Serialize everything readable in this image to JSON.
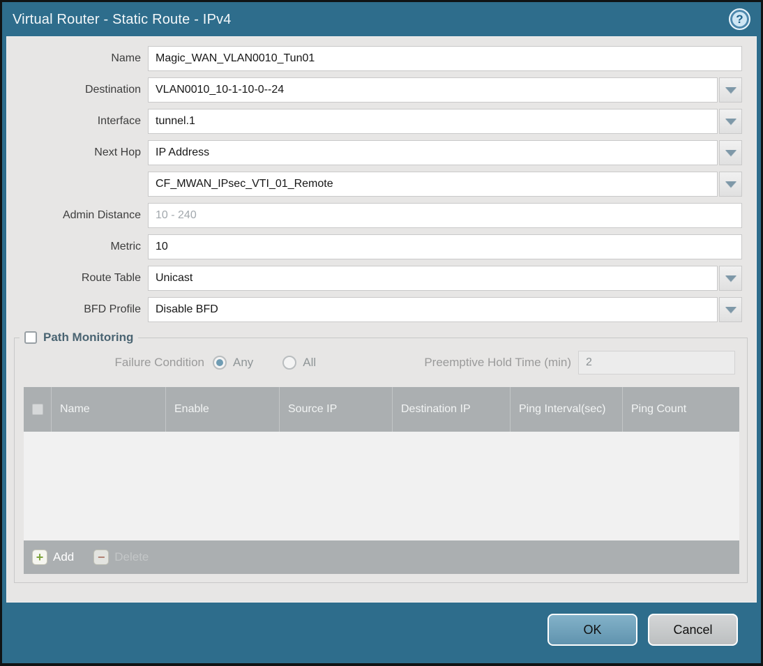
{
  "dialog": {
    "title": "Virtual Router - Static Route - IPv4",
    "help_icon": "?",
    "fields": {
      "name": {
        "label": "Name",
        "value": "Magic_WAN_VLAN0010_Tun01"
      },
      "destination": {
        "label": "Destination",
        "value": "VLAN0010_10-1-10-0--24"
      },
      "interface": {
        "label": "Interface",
        "value": "tunnel.1"
      },
      "next_hop": {
        "label": "Next Hop",
        "value": "IP Address"
      },
      "next_hop_addr": {
        "label": "",
        "value": "CF_MWAN_IPsec_VTI_01_Remote"
      },
      "admin_distance": {
        "label": "Admin Distance",
        "value": "",
        "placeholder": "10 - 240"
      },
      "metric": {
        "label": "Metric",
        "value": "10"
      },
      "route_table": {
        "label": "Route Table",
        "value": "Unicast"
      },
      "bfd_profile": {
        "label": "BFD Profile",
        "value": "Disable BFD"
      }
    },
    "path_monitoring": {
      "label": "Path Monitoring",
      "checked": false,
      "failure_condition": {
        "label": "Failure Condition",
        "option_any": "Any",
        "option_all": "All",
        "selected": "Any"
      },
      "preemptive_hold_time": {
        "label": "Preemptive Hold Time (min)",
        "value": "2",
        "disabled": true
      },
      "table": {
        "columns": [
          "Name",
          "Enable",
          "Source IP",
          "Destination IP",
          "Ping Interval(sec)",
          "Ping Count"
        ],
        "rows": []
      },
      "add_label": "Add",
      "delete_label": "Delete",
      "delete_disabled": true
    },
    "buttons": {
      "ok": "OK",
      "cancel": "Cancel"
    },
    "colors": {
      "titlebar_teal": "#2e6d8c",
      "panel_bg": "#e7e6e5",
      "table_header_gray": "#abafb1",
      "ok_button_blue": "#6fa3bd",
      "cancel_button_gray": "#c8cbcc",
      "add_icon_green": "#7da33b",
      "delete_icon_red": "#b4725f",
      "heading_slate": "#4a6472"
    }
  }
}
